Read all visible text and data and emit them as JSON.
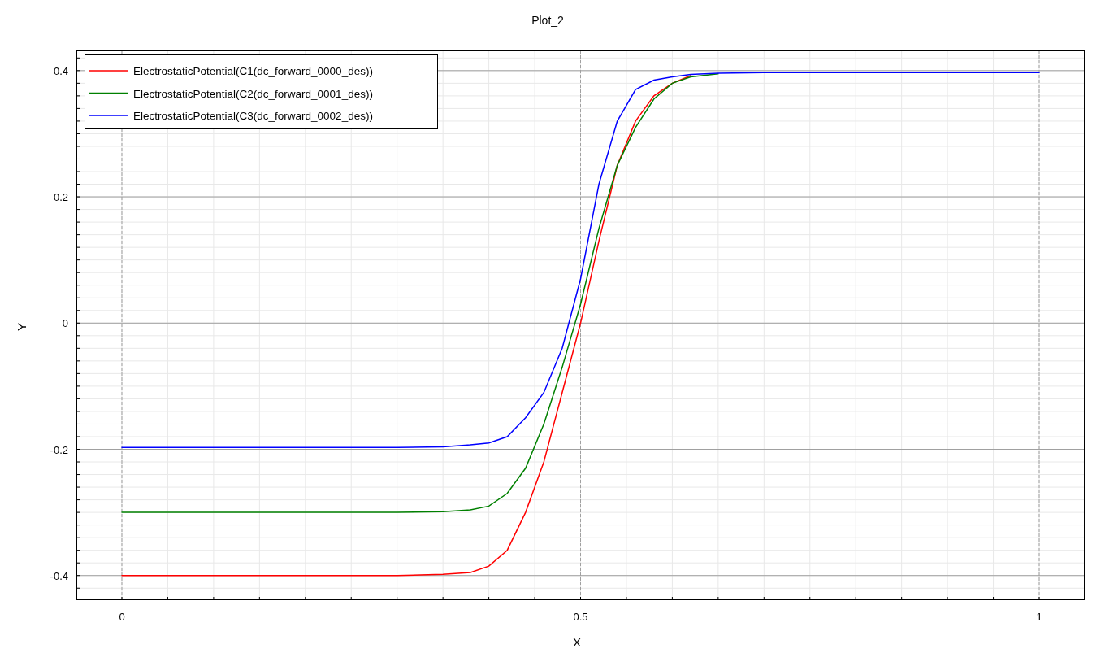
{
  "chart": {
    "chart_data": {
      "type": "line",
      "title": "Plot_2",
      "xlabel": "X",
      "ylabel": "Y",
      "x": [
        0,
        0.3,
        0.35,
        0.38,
        0.4,
        0.42,
        0.44,
        0.46,
        0.48,
        0.5,
        0.52,
        0.54,
        0.56,
        0.58,
        0.6,
        0.62,
        0.65,
        0.7,
        1
      ],
      "series": [
        {
          "name": "ElectrostaticPotential(C1(dc_forward_0000_des))",
          "color": "#ff0000",
          "values": [
            -0.4,
            -0.4,
            -0.398,
            -0.395,
            -0.385,
            -0.36,
            -0.3,
            -0.22,
            -0.11,
            0.0,
            0.13,
            0.25,
            0.32,
            0.36,
            0.38,
            0.392,
            null,
            null,
            null
          ]
        },
        {
          "name": "ElectrostaticPotential(C2(dc_forward_0001_des))",
          "color": "#008000",
          "values": [
            -0.3,
            -0.3,
            -0.299,
            -0.296,
            -0.29,
            -0.27,
            -0.23,
            -0.16,
            -0.07,
            0.03,
            0.15,
            0.25,
            0.31,
            0.355,
            0.38,
            0.39,
            0.395,
            null,
            null
          ]
        },
        {
          "name": "ElectrostaticPotential(C3(dc_forward_0002_des))",
          "color": "#0000ff",
          "values": [
            -0.197,
            -0.197,
            -0.196,
            -0.193,
            -0.19,
            -0.18,
            -0.15,
            -0.11,
            -0.04,
            0.07,
            0.22,
            0.32,
            0.37,
            0.385,
            0.39,
            0.394,
            0.396,
            0.397,
            0.397
          ]
        }
      ],
      "xlim": [
        -0.0496,
        1.0496
      ],
      "ylim": [
        -0.439,
        0.432
      ],
      "xticks": [
        0,
        0.5,
        1
      ],
      "yticks": [
        -0.4,
        -0.2,
        0,
        0.2,
        0.4
      ],
      "grid": true,
      "legend": true
    }
  }
}
